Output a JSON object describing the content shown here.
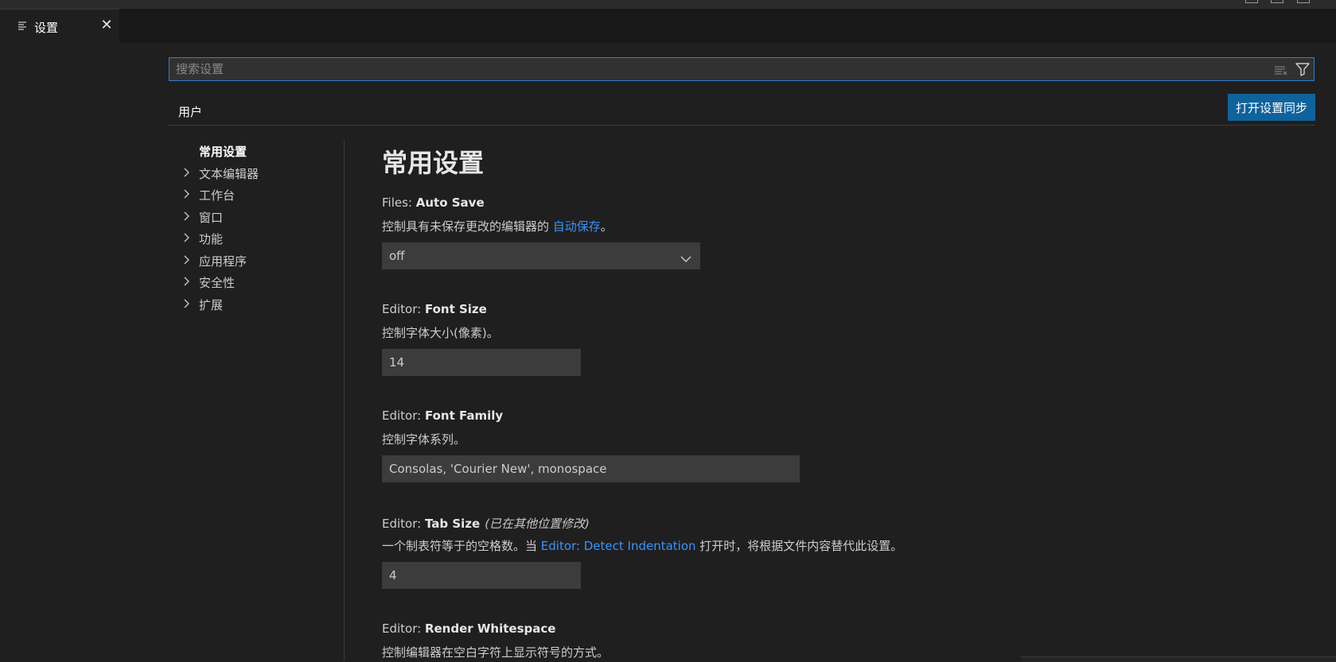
{
  "tab": {
    "title": "设置",
    "icon": "settings-list-icon"
  },
  "search": {
    "placeholder": "搜索设置",
    "value": ""
  },
  "scope": {
    "user_tab": "用户",
    "sync_button": "打开设置同步"
  },
  "toc": [
    {
      "label": "常用设置",
      "active": true
    },
    {
      "label": "文本编辑器"
    },
    {
      "label": "工作台"
    },
    {
      "label": "窗口"
    },
    {
      "label": "功能"
    },
    {
      "label": "应用程序"
    },
    {
      "label": "安全性"
    },
    {
      "label": "扩展"
    }
  ],
  "main": {
    "section_title": "常用设置",
    "auto_save": {
      "category": "Files: ",
      "name": "Auto Save",
      "desc_before": "控制具有未保存更改的编辑器的 ",
      "desc_link": "自动保存",
      "desc_after": "。",
      "value": "off"
    },
    "font_size": {
      "category": "Editor: ",
      "name": "Font Size",
      "desc": "控制字体大小(像素)。",
      "value": "14"
    },
    "font_family": {
      "category": "Editor: ",
      "name": "Font Family",
      "desc": "控制字体系列。",
      "value": "Consolas, 'Courier New', monospace"
    },
    "tab_size": {
      "category": "Editor: ",
      "name": "Tab Size",
      "modified": "(已在其他位置修改)",
      "desc_before": "一个制表符等于的空格数。当 ",
      "desc_link": "Editor: Detect Indentation",
      "desc_after": " 打开时，将根据文件内容替代此设置。",
      "value": "4"
    },
    "render_whitespace": {
      "category": "Editor: ",
      "name": "Render Whitespace",
      "desc": "控制编辑器在空白字符上显示符号的方式。"
    }
  },
  "colors": {
    "accent": "#2f7fd1",
    "button": "#0e639c",
    "link": "#3794ff",
    "background": "#1f1f1f"
  }
}
